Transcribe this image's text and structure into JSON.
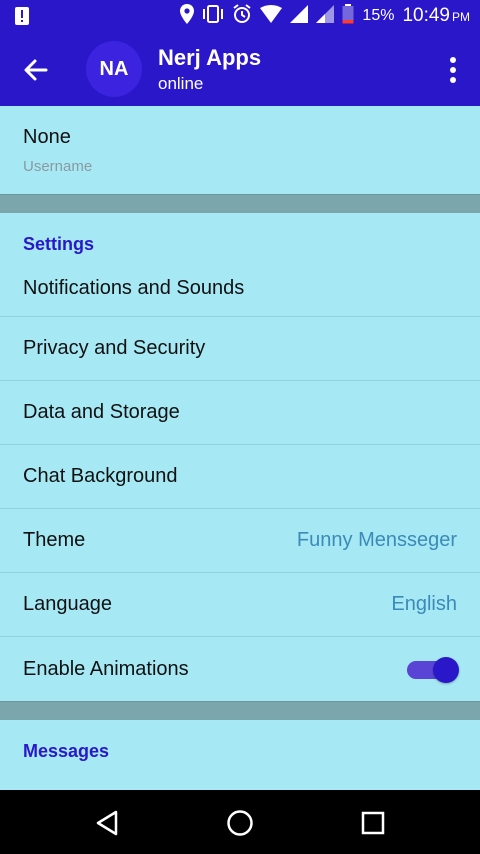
{
  "status_bar": {
    "battery_percent": "15%",
    "time": "10:49",
    "ampm": "PM",
    "icons": [
      "notification-icon",
      "location-icon",
      "vibrate-icon",
      "alarm-icon",
      "wifi-icon",
      "signal-icon",
      "signal-icon",
      "battery-icon"
    ]
  },
  "header": {
    "avatar_initials": "NA",
    "title": "Nerj Apps",
    "subtitle": "online",
    "back_icon": "back-arrow-icon",
    "menu_icon": "more-vert-icon",
    "color": "#2a17c9"
  },
  "user": {
    "username_value": "None",
    "username_label": "Username"
  },
  "settings": {
    "header": "Settings",
    "items": [
      {
        "label": "Notifications and Sounds"
      },
      {
        "label": "Privacy and Security"
      },
      {
        "label": "Data and Storage"
      },
      {
        "label": "Chat Background"
      },
      {
        "label": "Theme",
        "value": "Funny Mensseger"
      },
      {
        "label": "Language",
        "value": "English"
      },
      {
        "label": "Enable Animations",
        "toggle": true
      }
    ]
  },
  "messages": {
    "header": "Messages"
  },
  "nav_bar": {
    "icons": [
      "back-triangle-icon",
      "home-circle-icon",
      "recents-square-icon"
    ]
  }
}
